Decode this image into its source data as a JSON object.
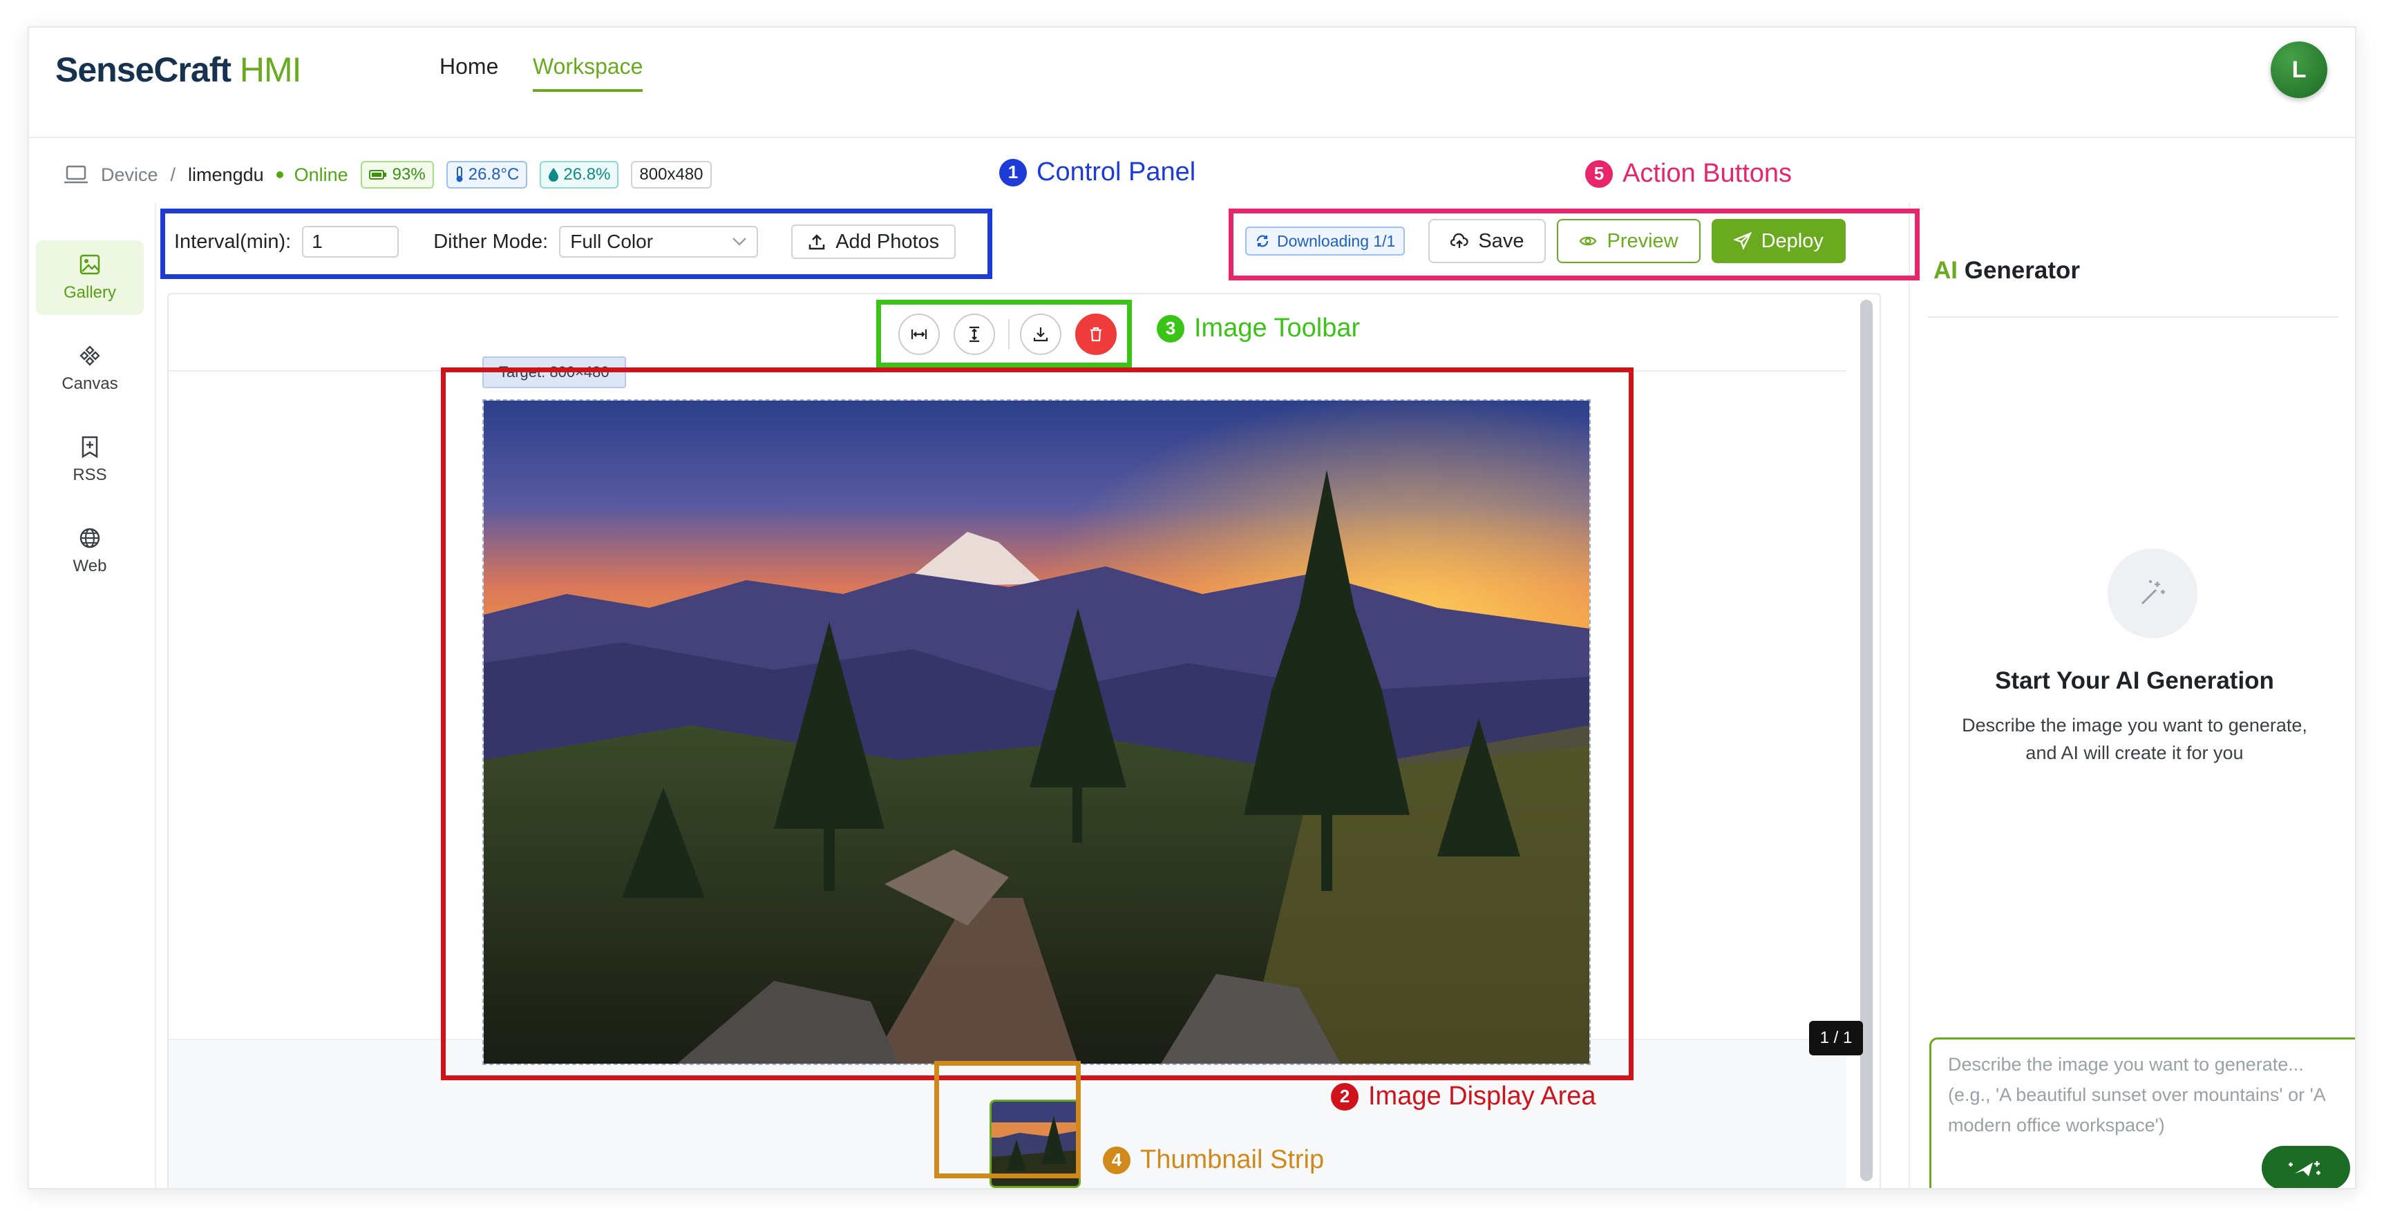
{
  "app": {
    "brand_main": "SenseCraft",
    "brand_accent": "HMI",
    "accent_color": "#6aaa1e"
  },
  "nav": {
    "home": "Home",
    "workspace": "Workspace",
    "avatar_letter": "L"
  },
  "device": {
    "label": "Device",
    "separator": "/",
    "name": "limengdu",
    "status": "Online",
    "battery": "93%",
    "temperature": "26.8°C",
    "humidity": "26.8%",
    "resolution": "800x480"
  },
  "controls": {
    "interval_label": "Interval(min):",
    "interval_value": "1",
    "dither_label": "Dither Mode:",
    "dither_value": "Full Color",
    "add_photos": "Add Photos"
  },
  "actions": {
    "downloading": "Downloading 1/1",
    "save": "Save",
    "preview": "Preview",
    "deploy": "Deploy"
  },
  "sidebar": {
    "items": [
      {
        "label": "Gallery",
        "icon": "image-icon",
        "active": true
      },
      {
        "label": "Canvas",
        "icon": "canvas-icon",
        "active": false
      },
      {
        "label": "RSS",
        "icon": "rss-icon",
        "active": false
      },
      {
        "label": "Web",
        "icon": "globe-icon",
        "active": false
      }
    ]
  },
  "image": {
    "target": "Target: 800×480",
    "page_indicator": "1 / 1",
    "toolbar": [
      "fit-width-icon",
      "fit-height-icon",
      "download-icon",
      "trash-icon"
    ]
  },
  "annotations": [
    {
      "num": "1",
      "label": "Control Panel",
      "color": "#1d3bd6"
    },
    {
      "num": "2",
      "label": "Image Display Area",
      "color": "#d0121a"
    },
    {
      "num": "3",
      "label": "Image Toolbar",
      "color": "#3bc418"
    },
    {
      "num": "4",
      "label": "Thumbnail Strip",
      "color": "#d08a1c"
    },
    {
      "num": "5",
      "label": "Action Buttons",
      "color": "#e8246a"
    }
  ],
  "ai": {
    "title_accent": "AI",
    "title_rest": "Generator",
    "heading": "Start Your AI Generation",
    "subtitle": "Describe the image you want to generate, and AI will create it for you",
    "placeholder": "Describe the image you want to generate... (e.g., 'A beautiful sunset over mountains' or 'A modern office workspace')"
  }
}
